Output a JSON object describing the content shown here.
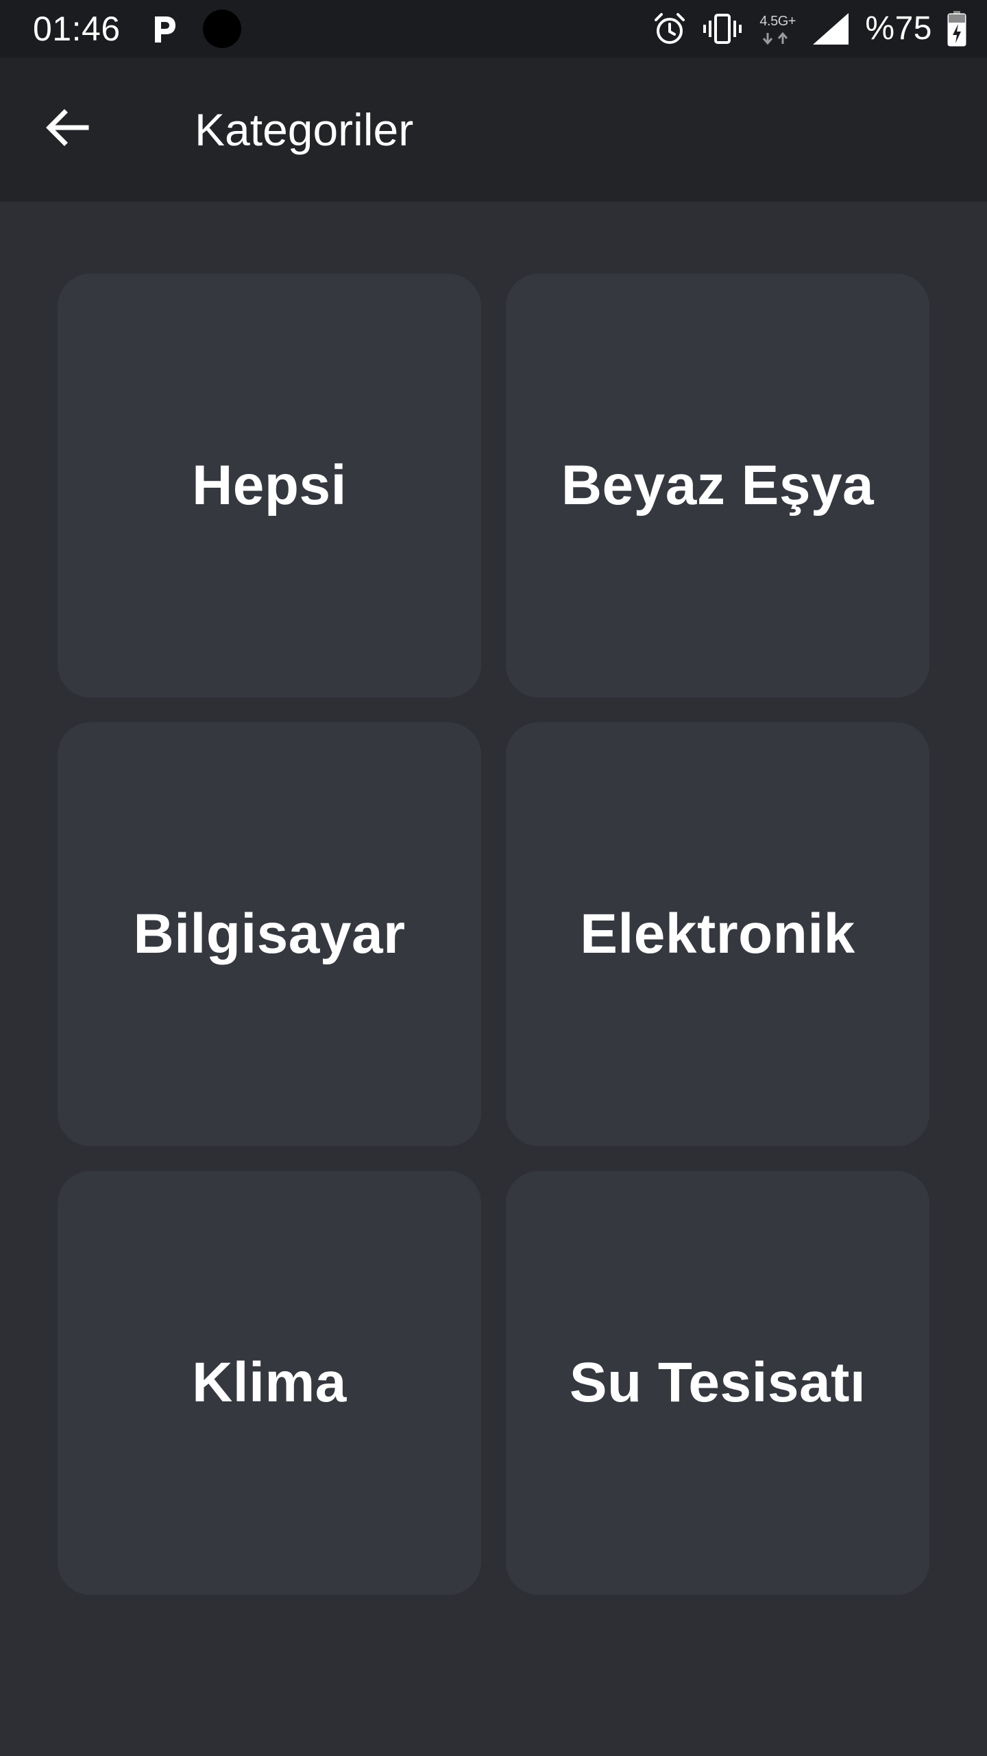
{
  "status_bar": {
    "time": "01:46",
    "battery_percent": "%75",
    "network_type": "4.5G+",
    "icons": [
      "parking-icon",
      "camera-cutout-icon",
      "alarm-icon",
      "vibrate-icon",
      "network-icon",
      "signal-icon",
      "battery-charging-icon"
    ]
  },
  "app_bar": {
    "title": "Kategoriler",
    "back_icon": "arrow-left-icon"
  },
  "categories": [
    {
      "label": "Hepsi"
    },
    {
      "label": "Beyaz Eşya"
    },
    {
      "label": "Bilgisayar"
    },
    {
      "label": "Elektronik"
    },
    {
      "label": "Klima"
    },
    {
      "label": "Su Tesisatı"
    }
  ],
  "colors": {
    "background": "#2e2f34",
    "status_bar": "#1b1c20",
    "app_bar": "#232428",
    "tile": "#363840",
    "text": "#ffffff"
  }
}
